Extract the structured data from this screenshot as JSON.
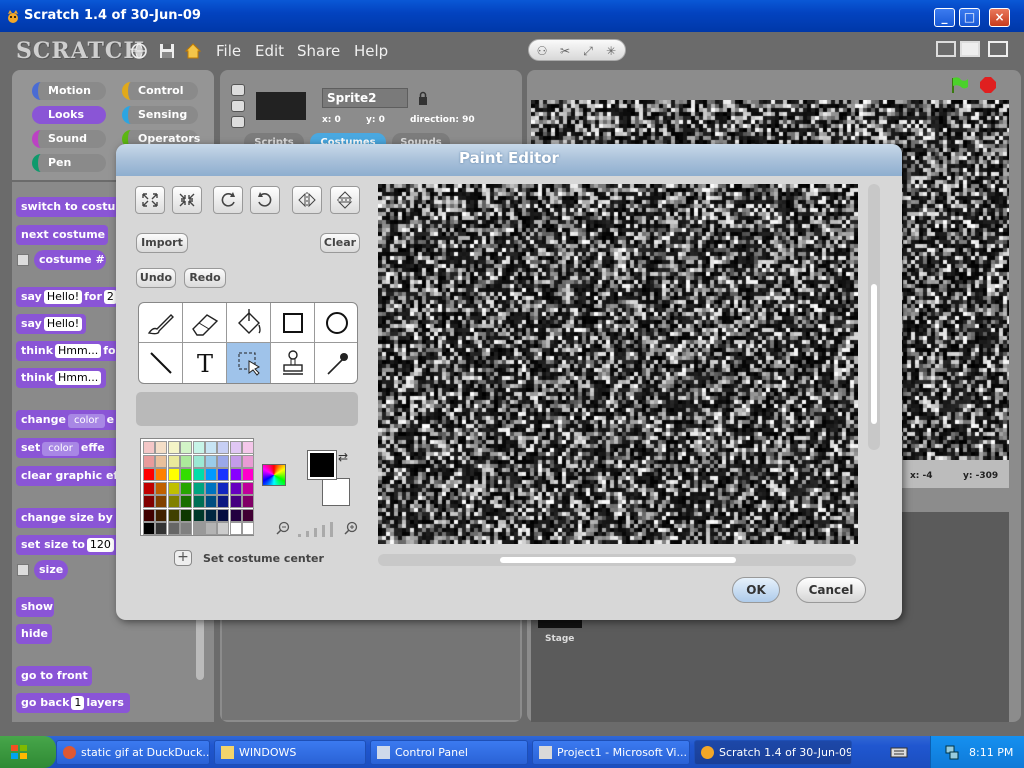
{
  "window": {
    "title": "Scratch 1.4 of 30-Jun-09",
    "controls": [
      "_",
      "□",
      "×"
    ]
  },
  "app": {
    "logo": "SCRATCH",
    "menu": [
      "File",
      "Edit",
      "Share",
      "Help"
    ]
  },
  "categories": [
    {
      "label": "Motion",
      "color": "#4a6cd4"
    },
    {
      "label": "Control",
      "color": "#e1a91a"
    },
    {
      "label": "Looks",
      "color": "#8a55d6"
    },
    {
      "label": "Sensing",
      "color": "#2ca5e2"
    },
    {
      "label": "Sound",
      "color": "#bb42c3"
    },
    {
      "label": "Operators",
      "color": "#5cb712"
    },
    {
      "label": "Pen",
      "color": "#0e9a6c"
    }
  ],
  "blocks": {
    "switch_costume": "switch to costume",
    "next_costume": "next costume",
    "costume_num": "costume #",
    "say_for_label": "say",
    "say_for_value": "Hello!",
    "say_for_suffix": "for",
    "say_for_secs": "2",
    "say_label": "say",
    "say_value": "Hello!",
    "think_for_label": "think",
    "think_for_value": "Hmm...",
    "think_for_suffix": "fo",
    "think_label": "think",
    "think_value": "Hmm...",
    "change_effect_label": "change",
    "change_effect_dd": "color",
    "change_effect_suffix": "e",
    "set_effect_label": "set",
    "set_effect_dd": "color",
    "set_effect_suffix": "effe",
    "clear_effects": "clear graphic ef",
    "change_size_label": "change size by",
    "set_size_label": "set size to",
    "set_size_value": "120",
    "size_reporter": "size",
    "show": "show",
    "hide": "hide",
    "go_front": "go to front",
    "go_back_label": "go back",
    "go_back_value": "1",
    "go_back_suffix": "layers"
  },
  "sprite": {
    "name": "Sprite2",
    "x_label": "x: 0",
    "y_label": "y: 0",
    "direction_label": "direction: 90",
    "tabs": [
      "Scripts",
      "Costumes",
      "Sounds"
    ]
  },
  "stage": {
    "x_readout": "x: -4",
    "y_readout": "y: -309",
    "thumb_label": "Stage"
  },
  "paint_editor": {
    "title": "Paint Editor",
    "import_label": "Import",
    "clear_label": "Clear",
    "undo_label": "Undo",
    "redo_label": "Redo",
    "set_center_label": "Set costume center",
    "ok_label": "OK",
    "cancel_label": "Cancel",
    "tools": [
      "paintbrush-icon",
      "eraser-icon",
      "fill-bucket-icon",
      "rectangle-icon",
      "ellipse-icon",
      "line-icon",
      "text-icon",
      "select-icon",
      "stamp-icon",
      "eyedropper-icon"
    ],
    "selected_tool": "select-icon",
    "foreground_color": "#000000",
    "background_color": "#ffffff",
    "palette": [
      [
        "#f4c7c7",
        "#f4dec7",
        "#f4f4c7",
        "#d2f4c7",
        "#c7f4e8",
        "#c7e4f4",
        "#c7cff4",
        "#e0c7f4",
        "#f4c7ea"
      ],
      [
        "#e99b9b",
        "#e9c09b",
        "#e9e99b",
        "#ace99b",
        "#9be9d4",
        "#9bcbe9",
        "#9ba8e9",
        "#c49be9",
        "#e99bd4"
      ],
      [
        "#ff0000",
        "#ff8000",
        "#ffff00",
        "#33dd00",
        "#00ddaa",
        "#0099ff",
        "#1a33ff",
        "#8800ff",
        "#ff00cc"
      ],
      [
        "#c00000",
        "#c06000",
        "#c0c000",
        "#26a500",
        "#00a580",
        "#0073c0",
        "#1326c0",
        "#6600c0",
        "#c0009a"
      ],
      [
        "#800000",
        "#804000",
        "#808000",
        "#196e00",
        "#006e55",
        "#004d80",
        "#0d1980",
        "#440080",
        "#800066"
      ],
      [
        "#400000",
        "#402000",
        "#404000",
        "#0d3700",
        "#00372a",
        "#002640",
        "#060d40",
        "#220040",
        "#400033"
      ],
      [
        "#000000",
        "#333333",
        "#666666",
        "#808080",
        "#999999",
        "#b3b3b3",
        "#cccccc",
        "#ffffff",
        "#ffffff"
      ]
    ]
  },
  "taskbar": {
    "start": "start",
    "tasks": [
      {
        "label": "static gif at DuckDuck...",
        "active": false
      },
      {
        "label": "WINDOWS",
        "active": false
      },
      {
        "label": "Control Panel",
        "active": false
      },
      {
        "label": "Project1 - Microsoft Vi...",
        "active": false
      },
      {
        "label": "Scratch 1.4 of 30-Jun-09",
        "active": true
      }
    ],
    "clock": "8:11 PM"
  }
}
